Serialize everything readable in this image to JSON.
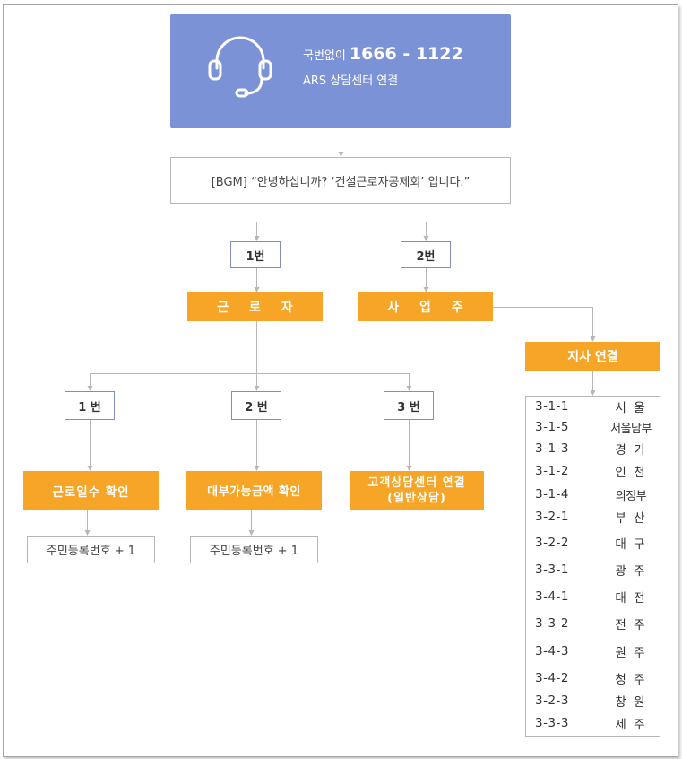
{
  "header": {
    "line1_prefix": "국번없이",
    "phone": "1666 - 1122",
    "line2": "ARS 상담센터 연결"
  },
  "greeting": "[BGM]  “안녕하십니까? ‘건설근로자공제회’ 입니다.”",
  "level1": {
    "option1": "1번",
    "option2": "2번",
    "worker": "근 로 자",
    "employer": "사 업 주",
    "branch_connect": "지사 연결"
  },
  "worker_menu": [
    {
      "number": "1 번",
      "action": "근로일수 확인",
      "detail": "주민등록번호 + 1"
    },
    {
      "number": "2 번",
      "action": "대부가능금액 확인",
      "detail": "주민등록번호 + 1"
    },
    {
      "number": "3 번",
      "action_line1": "고객상담센터 연결",
      "action_line2": "(일반상담)"
    }
  ],
  "branches": [
    {
      "code": "3-1-1",
      "name": "서 울"
    },
    {
      "code": "3-1-5",
      "name": "서울남부"
    },
    {
      "code": "3-1-3",
      "name": "경 기"
    },
    {
      "code": "3-1-2",
      "name": "인 천"
    },
    {
      "code": "3-1-4",
      "name": "의정부"
    },
    {
      "code": "3-2-1",
      "name": "부 산"
    },
    {
      "code": "3-2-2",
      "name": "대 구"
    },
    {
      "code": "3-3-1",
      "name": "광 주"
    },
    {
      "code": "3-4-1",
      "name": "대 전"
    },
    {
      "code": "3-3-2",
      "name": "전 주"
    },
    {
      "code": "3-4-3",
      "name": "원 주"
    },
    {
      "code": "3-4-2",
      "name": "청 주"
    },
    {
      "code": "3-2-3",
      "name": "창 원"
    },
    {
      "code": "3-3-3",
      "name": "제 주"
    }
  ],
  "colors": {
    "header_bg": "#7b93d6",
    "action_bg": "#f6a526",
    "number_border": "#7f8fb8",
    "connector": "#b7b7b7"
  },
  "icons": [
    "headset-icon"
  ]
}
